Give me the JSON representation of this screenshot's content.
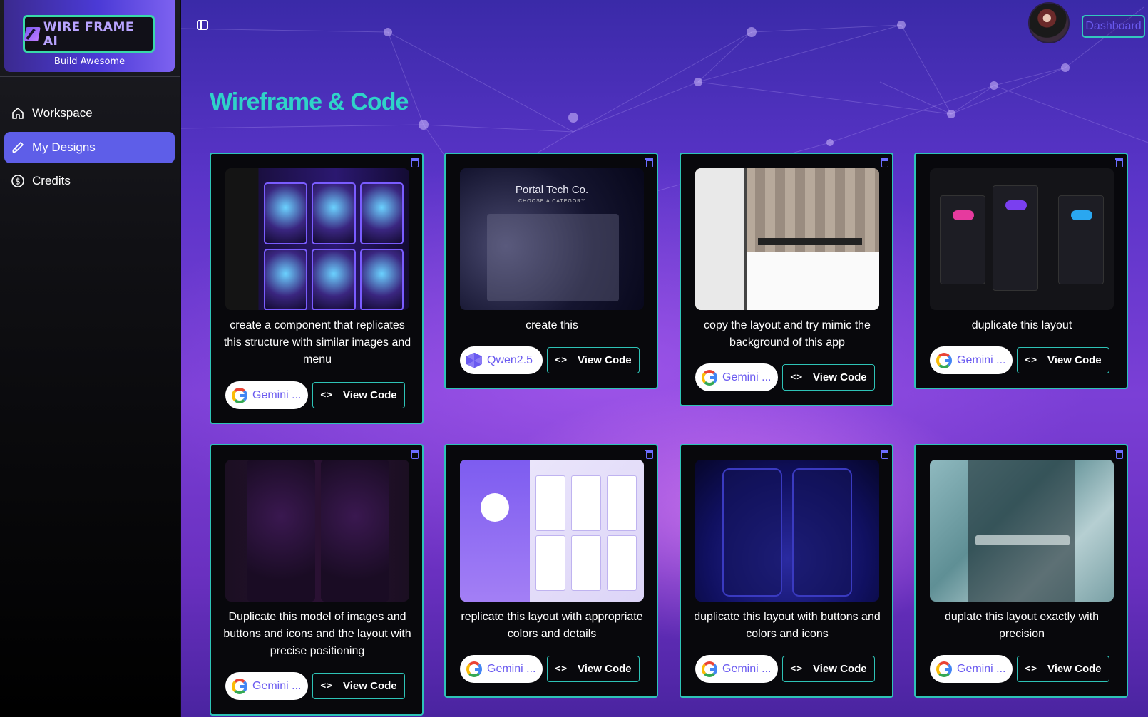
{
  "brand": {
    "logo_text": "WIRE FRAME AI",
    "tagline": "Build Awesome"
  },
  "nav": [
    {
      "label": "Workspace",
      "icon": "home-icon",
      "active": false
    },
    {
      "label": "My Designs",
      "icon": "brush-icon",
      "active": true
    },
    {
      "label": "Credits",
      "icon": "dollar-circle-icon",
      "active": false
    }
  ],
  "header": {
    "dashboard_label": "Dashboard"
  },
  "page": {
    "title": "Wireframe & Code"
  },
  "thumb_text": {
    "portal_title": "Portal Tech Co.",
    "portal_sub": "CHOOSE A CATEGORY"
  },
  "colors": {
    "accent": "#2ec3b7",
    "active_nav": "#5e5ee8",
    "model_text": "#6a5af0"
  },
  "cards": [
    {
      "prompt": "create a component that replicates this structure with similar images and menu",
      "model": "Gemini ...",
      "model_icon": "google-icon",
      "view_label": "View Code"
    },
    {
      "prompt": "create this",
      "model": "Qwen2.5",
      "model_icon": "qwen-icon",
      "view_label": "View Code"
    },
    {
      "prompt": "copy the layout and try mimic the background of this app",
      "model": "Gemini ...",
      "model_icon": "google-icon",
      "view_label": "View Code"
    },
    {
      "prompt": "duplicate this layout",
      "model": "Gemini ...",
      "model_icon": "google-icon",
      "view_label": "View Code"
    },
    {
      "prompt": "Duplicate this model of images and buttons and icons and the layout with precise positioning",
      "model": "Gemini ...",
      "model_icon": "google-icon",
      "view_label": "View Code"
    },
    {
      "prompt": "replicate this layout with appropriate colors and details",
      "model": "Gemini ...",
      "model_icon": "google-icon",
      "view_label": "View Code"
    },
    {
      "prompt": "duplicate this layout with buttons and colors and icons",
      "model": "Gemini ...",
      "model_icon": "google-icon",
      "view_label": "View Code"
    },
    {
      "prompt": "duplate this layout exactly with precision",
      "model": "Gemini ...",
      "model_icon": "google-icon",
      "view_label": "View Code"
    }
  ]
}
